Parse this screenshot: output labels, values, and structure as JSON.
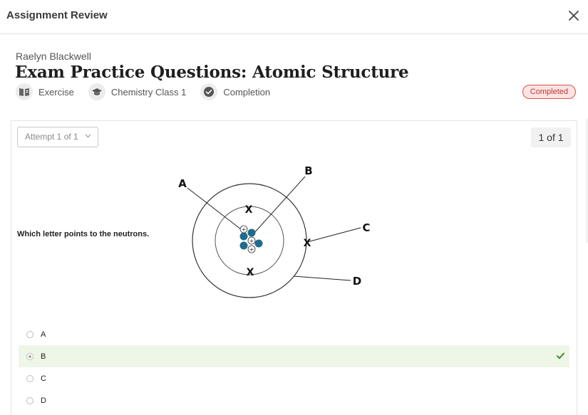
{
  "header": {
    "title": "Assignment Review",
    "close_icon": "close-icon"
  },
  "assignment": {
    "student_name": "Raelyn Blackwell",
    "title": "Exam Practice Questions: Atomic Structure",
    "meta": [
      {
        "icon": "book-icon",
        "label": "Exercise"
      },
      {
        "icon": "graduation-cap-icon",
        "label": "Chemistry Class 1"
      },
      {
        "icon": "check-circle-icon",
        "label": "Completion"
      }
    ],
    "status": "Completed",
    "status_color": "#d9534f"
  },
  "attempt": {
    "label": "Attempt 1 of 1"
  },
  "pager": {
    "label": "1 of 1"
  },
  "question": {
    "text": "Which letter points to the neutrons.",
    "diagram": {
      "labels": [
        "A",
        "B",
        "C",
        "D"
      ],
      "nucleus_color": "#1f6b8e",
      "electron_marks": [
        "X",
        "X",
        "X"
      ]
    }
  },
  "options": [
    {
      "label": "A",
      "selected": false,
      "correct": false
    },
    {
      "label": "B",
      "selected": true,
      "correct": true
    },
    {
      "label": "C",
      "selected": false,
      "correct": false
    },
    {
      "label": "D",
      "selected": false,
      "correct": false
    }
  ],
  "colors": {
    "correct_check": "#3e8e1f",
    "selected_bg": "#eef6e8"
  }
}
